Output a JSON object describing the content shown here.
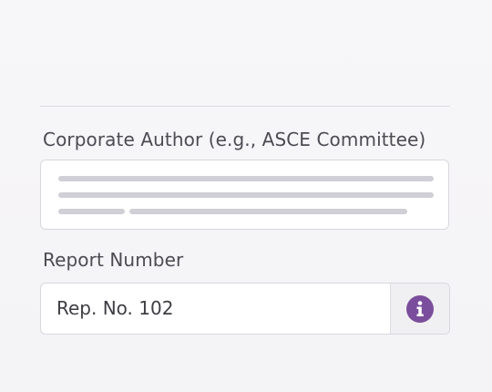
{
  "form": {
    "corporate_author": {
      "label": "Corporate Author (e.g., ASCE Committee)"
    },
    "report_number": {
      "label": "Report Number",
      "value": "Rep. No. 102",
      "addon_icon": "info-icon"
    }
  },
  "colors": {
    "info_icon": "#7a4e9c",
    "border": "#d9d7de",
    "label_text": "#4d4b52"
  }
}
